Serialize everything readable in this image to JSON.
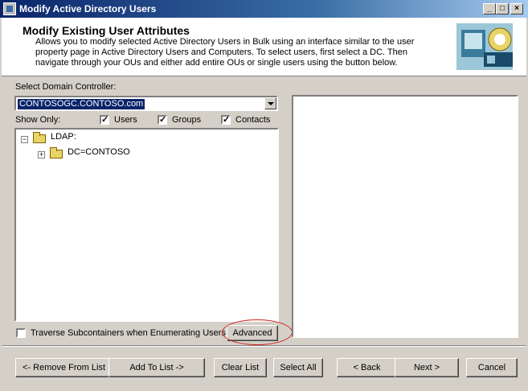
{
  "window": {
    "title": "Modify Active Directory Users"
  },
  "header": {
    "title": "Modify Existing User Attributes",
    "description": "Allows you to modify selected Active Directory Users in Bulk using an interface similar to the user property page in Active Directory Users and Computers.  To select users, first select a DC.  Then navigate through your OUs and either add entire OUs or single users using the button below."
  },
  "domain": {
    "label": "Select Domain Controller:",
    "selected": "CONTOSOGC.CONTOSO.com"
  },
  "filters": {
    "label": "Show Only:",
    "users": {
      "label": "Users",
      "checked": true
    },
    "groups": {
      "label": "Groups",
      "checked": true
    },
    "contacts": {
      "label": "Contacts",
      "checked": true
    }
  },
  "tree": {
    "root": {
      "label": "LDAP:",
      "expander": "−"
    },
    "child": {
      "label": "DC=CONTOSO",
      "expander": "+"
    }
  },
  "traverse": {
    "label": "Traverse Subcontainers when Enumerating Users",
    "checked": false
  },
  "buttons": {
    "advanced": "Advanced",
    "remove": "<- Remove From List",
    "add": "Add To List ->",
    "clear": "Clear List",
    "select_all": "Select All",
    "back": "< Back",
    "next": "Next >",
    "cancel": "Cancel"
  },
  "colors": {
    "titlebar": "#0a246a",
    "selection": "#0a246a",
    "highlight_oval": "#d02020",
    "face": "#d4d0c8"
  },
  "icons": [
    "window-app-icon",
    "minimize-icon",
    "maximize-icon",
    "close-icon",
    "folder-icon",
    "dropdown-arrow-icon",
    "wizard-logo"
  ]
}
